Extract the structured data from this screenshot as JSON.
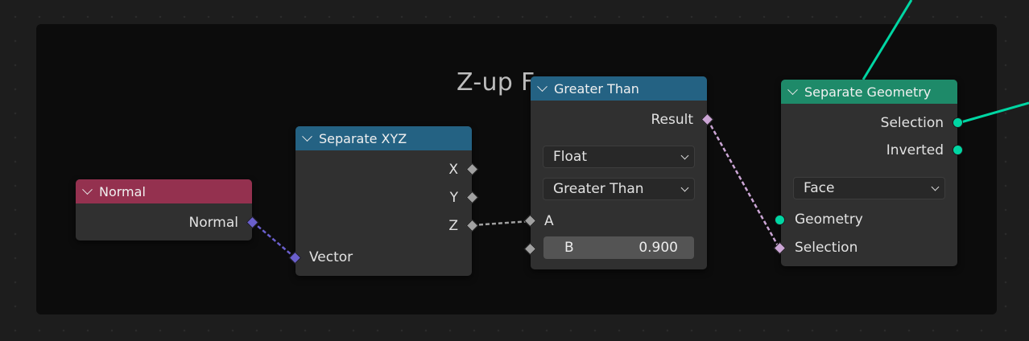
{
  "frame": {
    "title": "Z-up Face"
  },
  "nodes": {
    "normal": {
      "title": "Normal",
      "output": "Normal",
      "header_color": "#94314f"
    },
    "separate_xyz": {
      "title": "Separate XYZ",
      "outputs": [
        "X",
        "Y",
        "Z"
      ],
      "input": "Vector",
      "header_color": "#246283"
    },
    "greater_than": {
      "title": "Greater Than",
      "output": "Result",
      "data_type": "Float",
      "operation": "Greater Than",
      "input_a": "A",
      "input_b_label": "B",
      "input_b_value": "0.900",
      "header_color": "#246283"
    },
    "separate_geometry": {
      "title": "Separate Geometry",
      "outputs": [
        "Selection",
        "Inverted"
      ],
      "domain": "Face",
      "inputs": [
        "Geometry",
        "Selection"
      ],
      "header_color": "#1e8a69"
    }
  },
  "socket_colors": {
    "vector": "#6a5fcc",
    "float": "#a1a1a1",
    "boolean": "#cca6d6",
    "geometry": "#00d6a3"
  }
}
